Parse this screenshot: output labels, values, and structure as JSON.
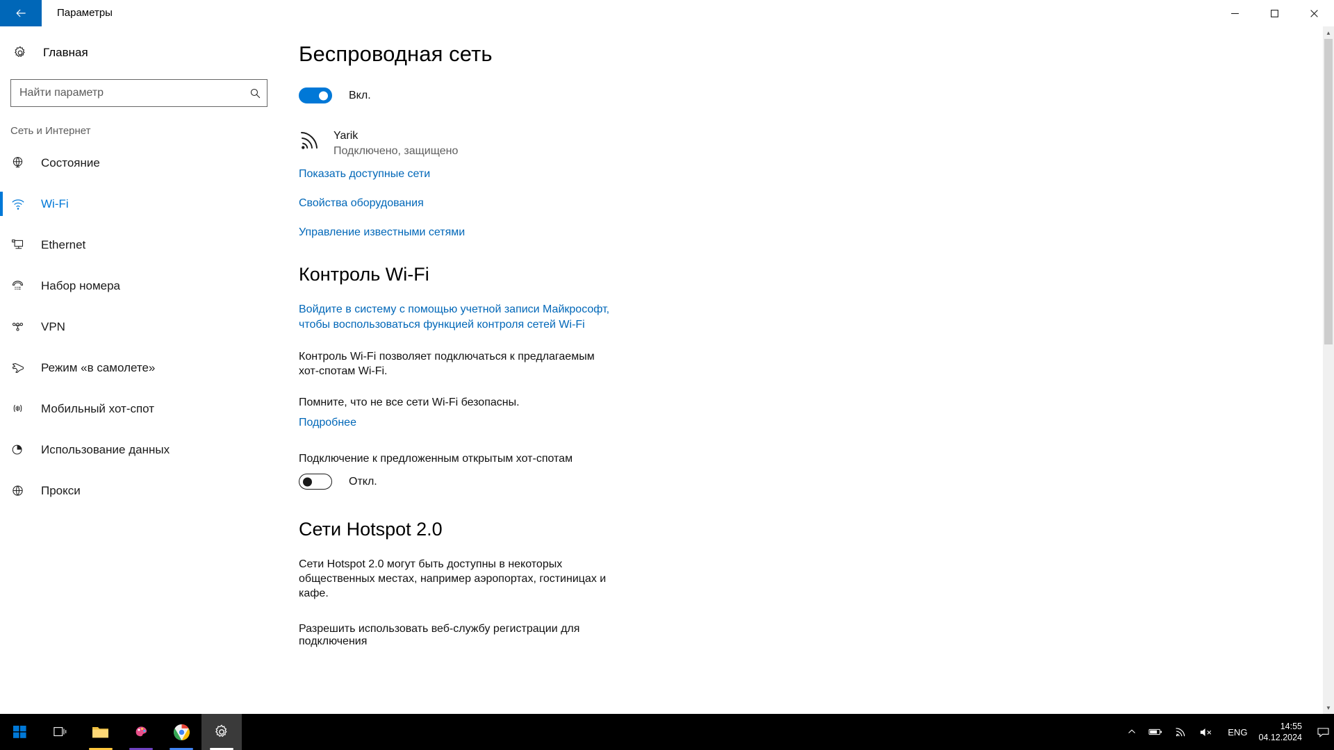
{
  "window": {
    "title": "Параметры",
    "back_icon": "back-arrow-icon",
    "minimize_label": "—",
    "maximize_label": "□",
    "close_label": "✕"
  },
  "sidebar": {
    "home": {
      "label": "Главная",
      "icon": "gear-icon"
    },
    "search": {
      "placeholder": "Найти параметр",
      "value": "",
      "icon": "search-icon"
    },
    "group_header": "Сеть и Интернет",
    "items": [
      {
        "label": "Состояние",
        "icon": "globe-icon",
        "active": false
      },
      {
        "label": "Wi-Fi",
        "icon": "wifi-icon",
        "active": true
      },
      {
        "label": "Ethernet",
        "icon": "monitor-icon",
        "active": false
      },
      {
        "label": "Набор номера",
        "icon": "phone-handset-icon",
        "active": false
      },
      {
        "label": "VPN",
        "icon": "vpn-icon",
        "active": false
      },
      {
        "label": "Режим «в самолете»",
        "icon": "airplane-icon",
        "active": false
      },
      {
        "label": "Мобильный хот-спот",
        "icon": "hotspot-icon",
        "active": false
      },
      {
        "label": "Использование данных",
        "icon": "pie-chart-icon",
        "active": false
      },
      {
        "label": "Прокси",
        "icon": "globe-icon",
        "active": false
      }
    ]
  },
  "main": {
    "page_title": "Беспроводная сеть",
    "wifi_toggle": {
      "state": "on",
      "label": "Вкл."
    },
    "network": {
      "icon": "wifi-signal-icon",
      "name": "Yarik",
      "status": "Подключено, защищено"
    },
    "links": [
      "Показать доступные сети",
      "Свойства оборудования",
      "Управление известными сетями"
    ],
    "wifi_control": {
      "heading": "Контроль Wi-Fi",
      "signin_link_line1": "Войдите в систему с помощью учетной записи Майкрософт,",
      "signin_link_line2": "чтобы воспользоваться функцией контроля сетей Wi-Fi",
      "para1": "Контроль Wi-Fi позволяет подключаться к предлагаемым хот-спотам Wi-Fi.",
      "para2": "Помните, что не все сети Wi-Fi безопасны.",
      "more_link": "Подробнее",
      "hotspot_setting_label": "Подключение к предложенным открытым хот-спотам",
      "hotspot_toggle": {
        "state": "off",
        "label": "Откл."
      }
    },
    "hotspot20": {
      "heading": "Сети Hotspot 2.0",
      "para": "Сети Hotspot 2.0 могут быть доступны в некоторых общественных местах, например аэропортах, гостиницах и кафе.",
      "bottom_label": "Разрешить использовать веб-службу регистрации для подключения"
    }
  },
  "taskbar": {
    "start_icon": "windows-start-icon",
    "task_view_icon": "task-view-icon",
    "apps": [
      {
        "name": "file-explorer",
        "accent": "#ffc83d"
      },
      {
        "name": "paint-3d",
        "accent": "#6f42c1"
      },
      {
        "name": "google-chrome",
        "accent": "#4285f4"
      },
      {
        "name": "settings",
        "accent": "#ffffff",
        "active": true
      }
    ],
    "tray": {
      "chevron_icon": "chevron-up-icon",
      "battery_icon": "battery-icon",
      "wifi_icon": "wifi-tray-icon",
      "volume_icon": "volume-muted-icon",
      "language": "ENG",
      "time": "14:55",
      "date": "04.12.2024",
      "notifications_icon": "notification-icon"
    }
  },
  "colors": {
    "accent": "#0078d7",
    "link": "#0067b8",
    "titlebar_back": "#0067b8",
    "taskbar_bg": "#000000"
  }
}
